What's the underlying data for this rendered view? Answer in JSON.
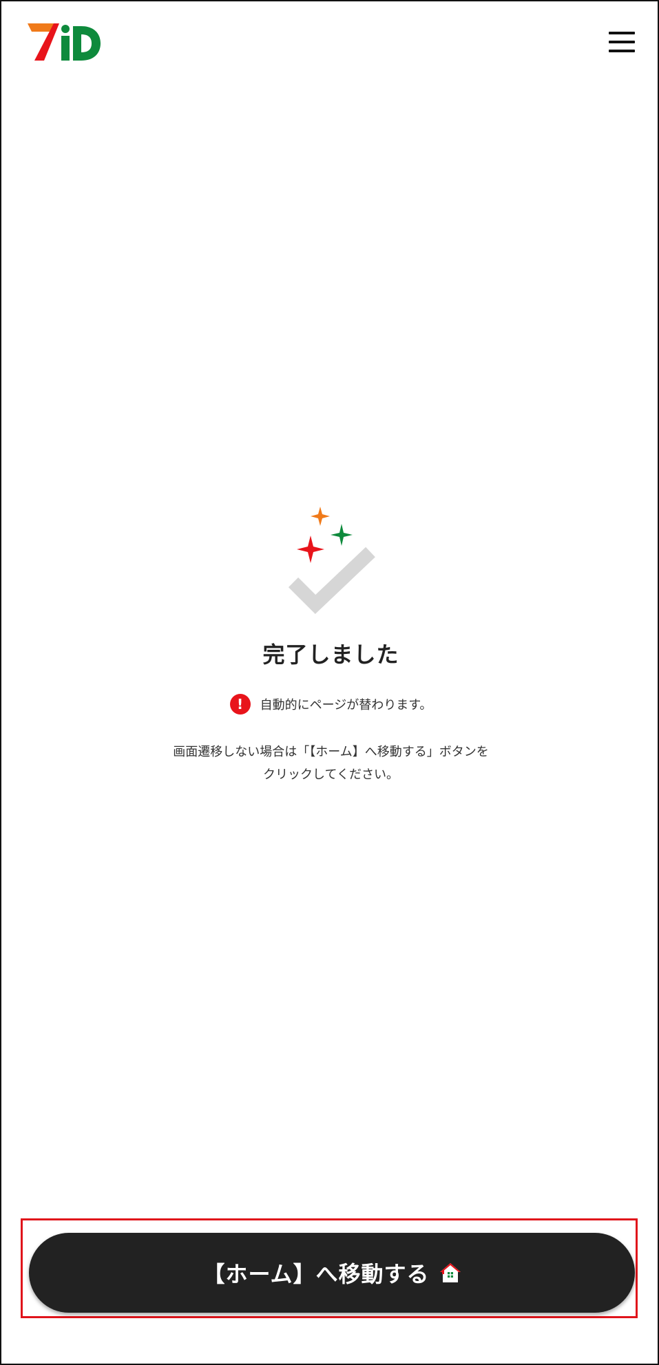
{
  "header": {
    "logo_text": "7iD",
    "menu_icon": "hamburger-menu-icon"
  },
  "main": {
    "success_icon": "check-sparkle-icon",
    "title": "完了しました",
    "notice_icon": "exclamation-alert-icon",
    "notice_icon_glyph": "!",
    "notice_text": "自動的にページが替わります。",
    "instructions_line1": "画面遷移しない場合は「【ホーム】へ移動する」ボタンを",
    "instructions_line2": "クリックしてください。"
  },
  "footer": {
    "home_button_label": "【ホーム】へ移動する",
    "home_button_icon": "house-icon"
  },
  "colors": {
    "accent_red": "#e8141b",
    "accent_orange": "#f07a1a",
    "accent_green": "#0e8a3c",
    "button_bg": "#222222",
    "checkmark_gray": "#d6d6d6"
  }
}
